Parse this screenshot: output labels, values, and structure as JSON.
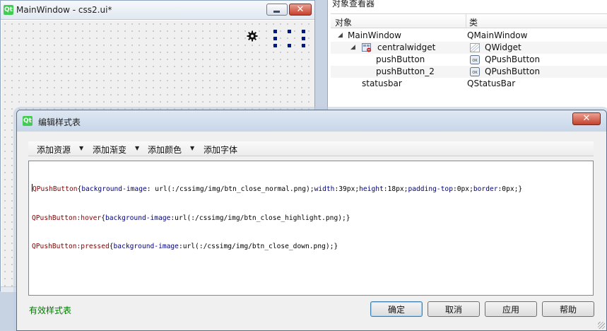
{
  "form_window": {
    "title": "MainWindow - css2.ui*"
  },
  "object_inspector": {
    "title": "对象查看器",
    "headers": {
      "object": "对象",
      "class": "类"
    },
    "rows": [
      {
        "object": "MainWindow",
        "class": "QMainWindow",
        "arrow": "◢"
      },
      {
        "object": "centralwidget",
        "class": "QWidget",
        "arrow": "◢"
      },
      {
        "object": "pushButton",
        "class": "QPushButton"
      },
      {
        "object": "pushButton_2",
        "class": "QPushButton"
      },
      {
        "object": "statusbar",
        "class": "QStatusBar"
      }
    ]
  },
  "stylesheet_dialog": {
    "title": "编辑样式表",
    "toolbar": [
      {
        "label": "添加资源",
        "arrow": "▼"
      },
      {
        "label": "添加渐变",
        "arrow": "▼"
      },
      {
        "label": "添加颜色",
        "arrow": "▼"
      },
      {
        "label": "添加字体"
      }
    ],
    "code_lines": [
      [
        {
          "t": "sel",
          "v": "QPushButton"
        },
        {
          "t": "val",
          "v": "{"
        },
        {
          "t": "prop",
          "v": "background-image"
        },
        {
          "t": "val",
          "v": ": url(:/cssimg/img/btn_close_normal.png);"
        },
        {
          "t": "prop",
          "v": "width"
        },
        {
          "t": "val",
          "v": ":39px;"
        },
        {
          "t": "prop",
          "v": "height"
        },
        {
          "t": "val",
          "v": ":18px;"
        },
        {
          "t": "prop",
          "v": "padding-top"
        },
        {
          "t": "val",
          "v": ":0px;"
        },
        {
          "t": "prop",
          "v": "border"
        },
        {
          "t": "val",
          "v": ":0px;}"
        }
      ],
      [
        {
          "t": "sel",
          "v": "QPushButton:hover"
        },
        {
          "t": "val",
          "v": "{"
        },
        {
          "t": "prop",
          "v": "background-image"
        },
        {
          "t": "val",
          "v": ":url(:/cssimg/img/btn_close_highlight.png);}"
        }
      ],
      [
        {
          "t": "sel",
          "v": "QPushButton:pressed"
        },
        {
          "t": "val",
          "v": "{"
        },
        {
          "t": "prop",
          "v": "background-image"
        },
        {
          "t": "val",
          "v": ":url(:/cssimg/img/btn_close_down.png);}"
        }
      ]
    ],
    "status": "有效样式表",
    "buttons": {
      "ok": "确定",
      "cancel": "取消",
      "apply": "应用",
      "help": "帮助"
    }
  },
  "glyphs": {
    "qt_logo": "Qt",
    "close": "✕"
  },
  "colors": {
    "valid_status": "#007a00",
    "selector": "#800000",
    "property": "#000080",
    "close_button": "#c7402c"
  }
}
